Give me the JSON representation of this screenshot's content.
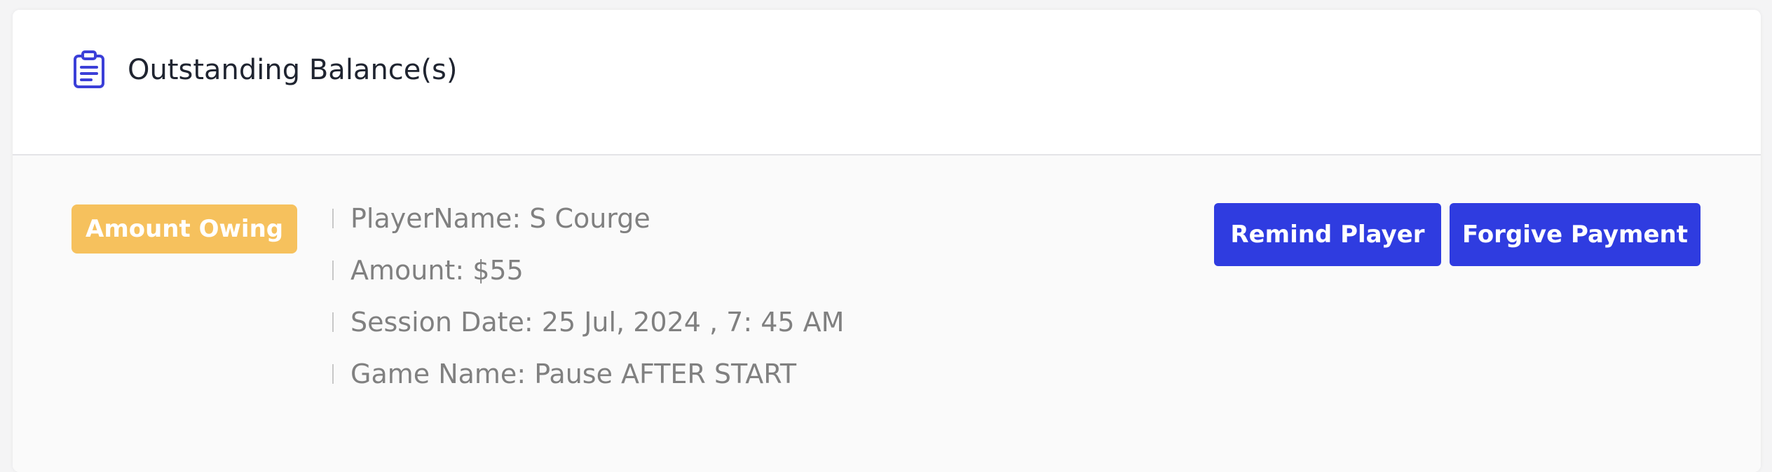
{
  "header": {
    "icon": "clipboard-icon",
    "title": "Outstanding Balance(s)"
  },
  "balance": {
    "badge_label": "Amount Owing",
    "details": [
      "PlayerName: S Courge",
      "Amount: $55",
      "Session Date: 25 Jul, 2024 , 7: 45 AM",
      "Game Name: Pause AFTER START"
    ],
    "actions": {
      "remind_label": "Remind Player",
      "forgive_label": "Forgive Payment"
    }
  },
  "colors": {
    "accent": "#2f3ce0",
    "badge": "#f6c15d"
  }
}
